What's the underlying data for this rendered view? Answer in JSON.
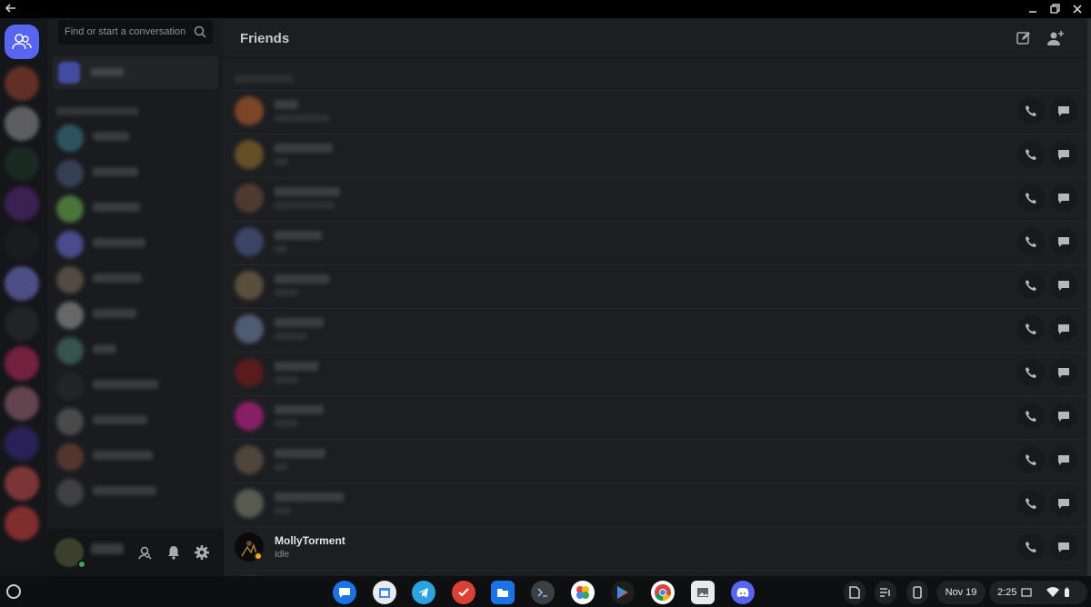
{
  "window": {
    "back_icon": "back-arrow-icon",
    "minimize_icon": "minimize-icon",
    "restore_icon": "restore-icon",
    "close_icon": "close-icon"
  },
  "search": {
    "placeholder": "Find or start a conversation",
    "icon": "search-icon"
  },
  "header": {
    "title": "Friends",
    "new_group_dm_icon": "new-message-icon",
    "add_friend_icon": "add-friend-icon"
  },
  "friends": {
    "visible_named": [
      {
        "name": "MollyTorment",
        "status": "Idle"
      }
    ]
  },
  "user_panel": {
    "icons": [
      "user-search-icon",
      "bell-icon",
      "gear-icon"
    ]
  },
  "shelf": {
    "date": "Nov 19",
    "time": "2:25",
    "apps": [
      "messages-app",
      "calendar-app",
      "telegram-app",
      "todoist-app",
      "files-app",
      "terminal-app",
      "photos-app",
      "play-store-app",
      "chrome-app",
      "gallery-app",
      "discord-app"
    ]
  },
  "colors": {
    "brand": "#5865f2",
    "online": "#3ba55d",
    "idle": "#faa81a",
    "background": "#1d1e21"
  }
}
